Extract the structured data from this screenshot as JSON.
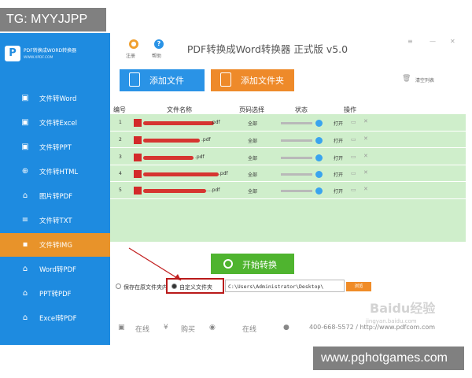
{
  "overlay": {
    "top_tag": "TG: MYYJJPP",
    "bottom_tag": "www.pghotgames.com"
  },
  "app": {
    "title": "PDF转换成Word转换器 正式版 v5.0",
    "toolbar": {
      "register_label": "注册",
      "help_label": "帮助"
    },
    "logo": {
      "name": "PDF转换成WORD转换器",
      "url": "WWW.XPDF.COM",
      "glyph": "P"
    },
    "sidebar": {
      "items": [
        {
          "label": "文件转Word",
          "icon": "word-icon",
          "active": false
        },
        {
          "label": "文件转Excel",
          "icon": "excel-icon",
          "active": false
        },
        {
          "label": "文件转PPT",
          "icon": "ppt-icon",
          "active": false
        },
        {
          "label": "文件转HTML",
          "icon": "globe-icon",
          "active": false
        },
        {
          "label": "图片转PDF",
          "icon": "pdf-icon",
          "active": false
        },
        {
          "label": "文件转TXT",
          "icon": "txt-icon",
          "active": false
        },
        {
          "label": "文件转IMG",
          "icon": "image-icon",
          "active": true
        },
        {
          "label": "Word转PDF",
          "icon": "pdf-icon",
          "active": false
        },
        {
          "label": "PPT转PDF",
          "icon": "pdf-icon",
          "active": false
        },
        {
          "label": "Excel转PDF",
          "icon": "pdf-icon",
          "active": false
        }
      ]
    },
    "buttons": {
      "add_file": "添加文件",
      "add_folder": "添加文件夹",
      "clear_list": "清空列表",
      "start": "开始转换",
      "browse": "浏览"
    },
    "table": {
      "headers": [
        "编号",
        "文件名称",
        "页码选择",
        "状态",
        "操作"
      ],
      "rows": [
        {
          "num": "1",
          "suffix": ".pdf",
          "pages": "全部",
          "open": "打开"
        },
        {
          "num": "2",
          "suffix": ".pdf",
          "pages": "全部",
          "open": "打开"
        },
        {
          "num": "3",
          "suffix": ".pdf",
          "pages": "全部",
          "open": "打开"
        },
        {
          "num": "4",
          "suffix": ".pdf",
          "pages": "全部",
          "open": "打开"
        },
        {
          "num": "5",
          "suffix": "....pdf",
          "pages": "全部",
          "open": "打开"
        }
      ]
    },
    "output": {
      "save_label": "保存在原文件夹内",
      "custom_label": "自定义文件夹",
      "path": "C:\\Users\\Administrator\\Desktop\\"
    },
    "footer": {
      "online": "在线",
      "buy": "购买",
      "online2": "在线",
      "phone": "400-668-5572 / http://www.pdfcom.com"
    }
  },
  "watermark": {
    "text": "Baidu经验",
    "sub": "jingyan.baidu.com"
  },
  "colors": {
    "sidebar": "#1e8be0",
    "active": "#e8932a",
    "table_bg": "#cfeecb",
    "start_btn": "#4fb42f"
  }
}
